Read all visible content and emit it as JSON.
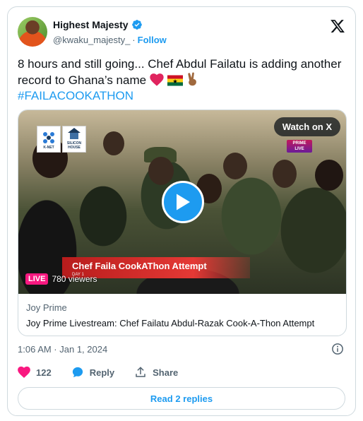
{
  "author": {
    "display_name": "Highest Majesty",
    "handle": "@kwaku_majesty_",
    "separator": "·",
    "follow_label": "Follow",
    "verified_color": "#1d9bf0"
  },
  "tweet": {
    "text": "8 hours and still going... Chef Abdul Failatu is adding another record to Ghana’s name",
    "emojis": [
      "red-heart",
      "ghana-flag",
      "victory-hand-medium-dark-skin"
    ],
    "hashtag": "#FAILACOOKATHON"
  },
  "media": {
    "watch_label": "Watch on X",
    "prime_badge": [
      "PRIME",
      "LIVE"
    ],
    "sponsor_logos": [
      {
        "name": "K-NET",
        "icon": "knet-logo"
      },
      {
        "name": "SILICON HOUSE",
        "icon": "silicon-house-logo"
      }
    ],
    "lower_third": "Chef Faila  CookAThon Attempt",
    "lower_third_sub": "DAY 1",
    "live_label": "LIVE",
    "viewers": "780 viewers",
    "source": "Joy Prime",
    "title": "Joy Prime Livestream: Chef Failatu Abdul-Razak Cook-A-Thon Attempt"
  },
  "meta": {
    "timestamp": "1:06 AM · Jan 1, 2024"
  },
  "actions": {
    "like_count": "122",
    "reply_label": "Reply",
    "share_label": "Share",
    "like_color": "#f91880",
    "reply_color": "#1d9bf0"
  },
  "read_replies_label": "Read 2 replies"
}
